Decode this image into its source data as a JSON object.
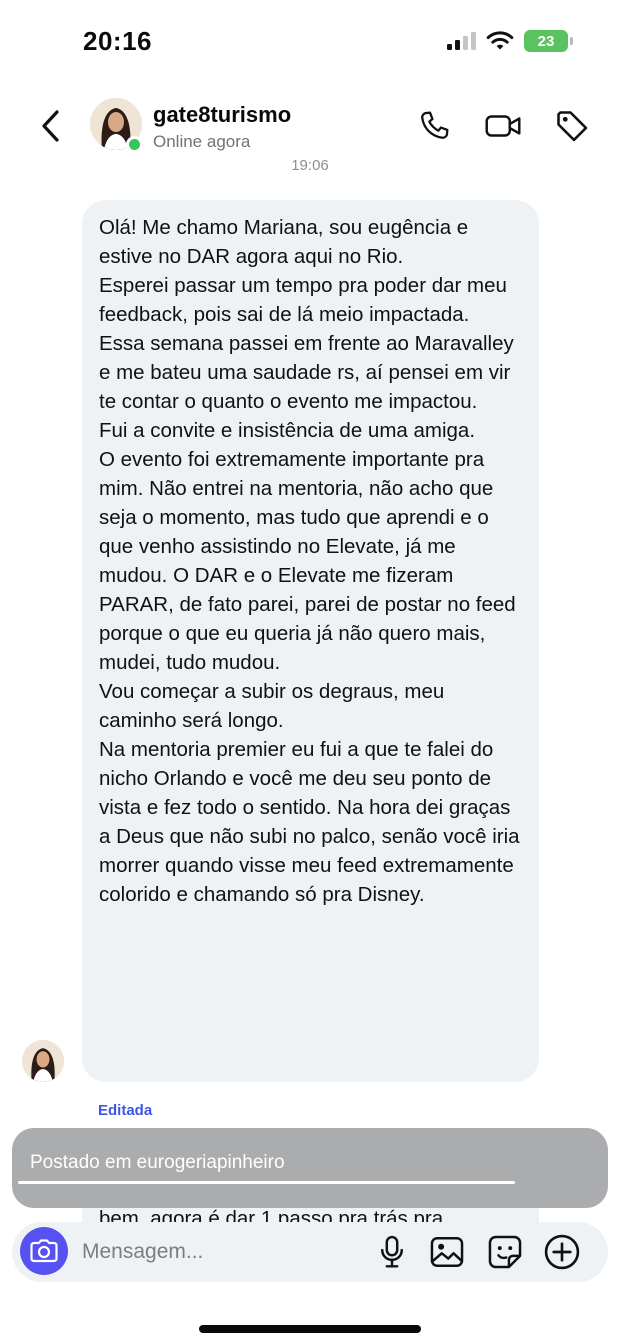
{
  "status_bar": {
    "time": "20:16",
    "battery": "23"
  },
  "header": {
    "name": "gate8turismo",
    "status": "Online agora"
  },
  "timestamp": "19:06",
  "message": {
    "paragraphs": [
      "Olá! Me chamo Mariana, sou eugência e estive no DAR agora aqui no Rio.",
      "Esperei passar um tempo pra poder dar meu feedback, pois sai de lá meio impactada.",
      "Essa semana passei em frente ao Maravalley e me bateu uma saudade rs, aí pensei em vir te contar o quanto o evento me impactou.",
      "Fui a convite e insistência de uma amiga.",
      "O evento foi extremamente importante pra mim. Não entrei na mentoria, não acho que seja o momento, mas tudo que aprendi e o que venho assistindo no Elevate, já me mudou. O DAR e o Elevate me fizeram PARAR, de fato parei, parei de postar no feed porque o que eu queria já não quero mais, mudei, tudo mudou.",
      "Vou começar a subir os degraus, meu caminho será longo.",
      "Na mentoria premier eu fui a que te falei do nicho Orlando e você me deu seu ponto de vista e fez todo o sentido. Na hora dei graças a Deus que não subi no palco, senão você iria morrer quando visse meu feed extremamente colorido e chamando só pra Disney."
    ],
    "edited_label": "Editada"
  },
  "next_message_partial": "bem, agora é dar 1 passo pra trás pra",
  "toast": {
    "text": "Postado em eurogeriapinheiro",
    "progress": 1.0
  },
  "composer": {
    "placeholder": "Mensagem..."
  },
  "colors": {
    "accent": "#5851f2",
    "online": "#33c759",
    "edited": "#3b55e6",
    "bubble": "#eff2f5"
  },
  "icons": [
    "back-chevron-icon",
    "phone-icon",
    "video-call-icon",
    "tag-icon",
    "camera-icon",
    "microphone-icon",
    "gallery-icon",
    "sticker-icon",
    "plus-circle-icon"
  ]
}
